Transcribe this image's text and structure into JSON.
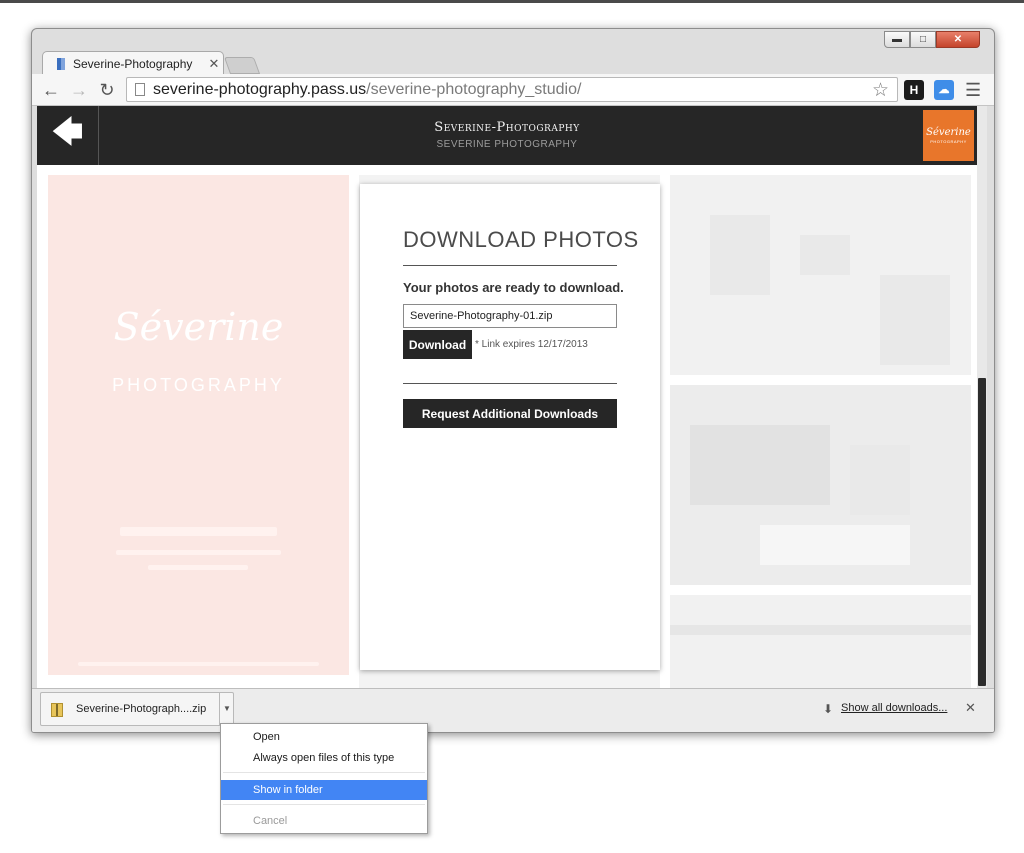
{
  "browser": {
    "tab_title": "Severine-Photography",
    "url_host": "severine-photography.pass.us",
    "url_path": "/severine-photography_studio/",
    "ext_h_label": "H"
  },
  "site": {
    "title": "Severine-Photography",
    "subtitle": "SEVERINE PHOTOGRAPHY",
    "logo_script": "Séverine",
    "logo_caps": "PHOTOGRAPHY",
    "panel_script": "Séverine",
    "panel_caps": "PHOTOGRAPHY"
  },
  "card": {
    "title": "DOWNLOAD PHOTOS",
    "lead": "Your photos are ready to download.",
    "file_name": "Severine-Photography-01.zip",
    "download_label": "Download",
    "expiry": "* Link expires 12/17/2013",
    "request_label": "Request Additional Downloads"
  },
  "shelf": {
    "item_name": "Severine-Photograph....zip",
    "show_all": "Show all downloads..."
  },
  "context_menu": {
    "items": [
      {
        "label": "Open"
      },
      {
        "label": "Always open files of this type"
      },
      {
        "label": "Show in folder"
      },
      {
        "label": "Cancel"
      }
    ]
  }
}
